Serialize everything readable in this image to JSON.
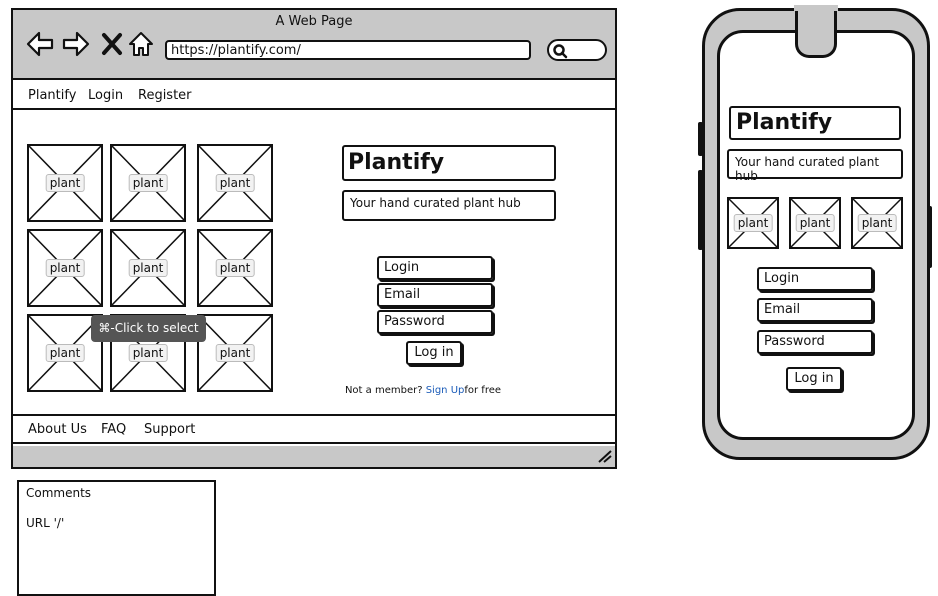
{
  "browser": {
    "window_title": "A Web Page",
    "url": "https://plantify.com/",
    "nav_icons": [
      "back-arrow-icon",
      "forward-arrow-icon",
      "close-x-icon",
      "home-icon"
    ]
  },
  "site": {
    "nav": [
      "Plantify",
      "Login",
      "Register"
    ],
    "brand": "Plantify",
    "tagline": "Your hand curated plant hub",
    "plant_caption": "plant",
    "tooltip": "⌘-Click to select",
    "form": {
      "login": "Login",
      "email": "Email",
      "password": "Password",
      "submit": "Log in"
    },
    "signup": {
      "prefix": "Not a member? ",
      "link": "Sign Up",
      "suffix": "for free"
    },
    "footer": [
      "About Us",
      "FAQ",
      "Support"
    ]
  },
  "comments": {
    "heading": "Comments",
    "body": "URL '/'"
  },
  "phone": {
    "brand": "Plantify",
    "tagline": "Your hand curated plant hub",
    "plant_caption": "plant",
    "form": {
      "login": "Login",
      "email": "Email",
      "password": "Password",
      "submit": "Log in"
    }
  },
  "colors": {
    "chrome_gray": "#c8c8c8",
    "link_blue": "#1a5bb8",
    "tooltip_bg": "#555555",
    "outline": "#111111"
  }
}
